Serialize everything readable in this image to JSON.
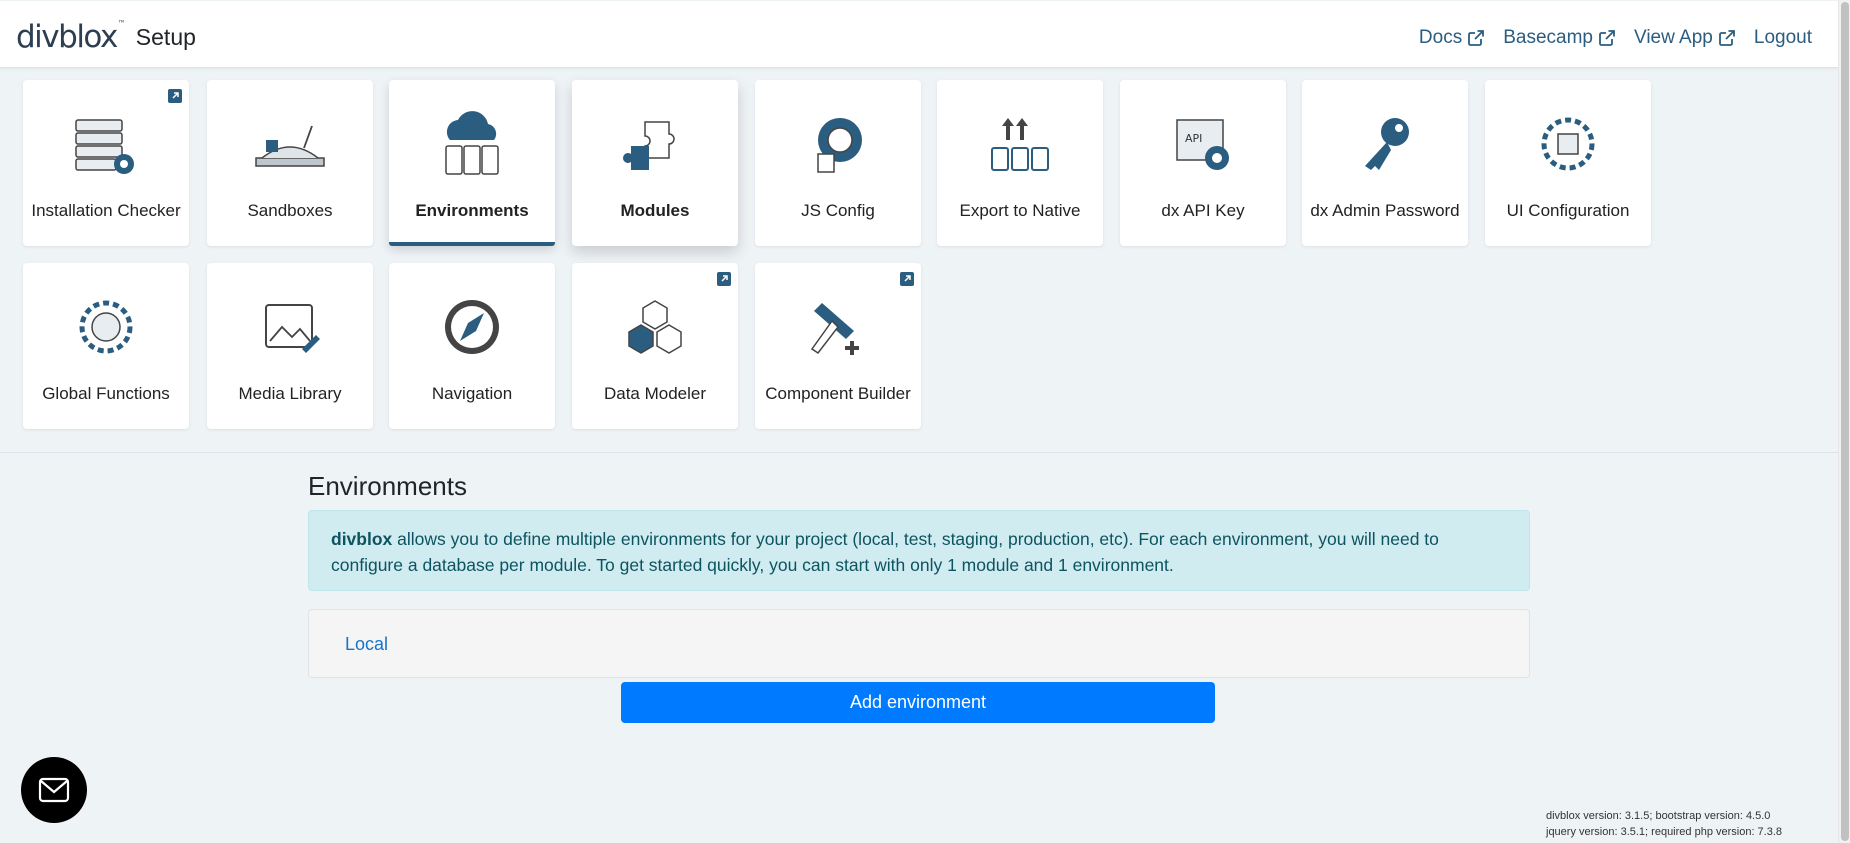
{
  "navbar": {
    "brand_logo": "divblox",
    "brand_tm": "™",
    "brand_title": "Setup",
    "links": [
      {
        "label": "Docs",
        "external": true
      },
      {
        "label": "Basecamp",
        "external": true
      },
      {
        "label": "View App",
        "external": true
      },
      {
        "label": "Logout",
        "external": false
      }
    ]
  },
  "tiles": [
    {
      "label": "Installation Checker",
      "icon": "server-gear-icon",
      "external": true
    },
    {
      "label": "Sandboxes",
      "icon": "sandbox-icon",
      "external": false
    },
    {
      "label": "Environments",
      "icon": "cloud-servers-icon",
      "external": false,
      "active": true
    },
    {
      "label": "Modules",
      "icon": "puzzle-icon",
      "external": false
    },
    {
      "label": "JS Config",
      "icon": "gear-wrench-icon",
      "external": false
    },
    {
      "label": "Export to Native",
      "icon": "export-icon",
      "external": false
    },
    {
      "label": "dx API Key",
      "icon": "api-gear-icon",
      "external": false
    },
    {
      "label": "dx Admin Password",
      "icon": "key-icon",
      "external": false
    },
    {
      "label": "UI Configuration",
      "icon": "ui-gear-icon",
      "external": false
    },
    {
      "label": "Global Functions",
      "icon": "globe-gear-icon",
      "external": false
    },
    {
      "label": "Media Library",
      "icon": "image-edit-icon",
      "external": false
    },
    {
      "label": "Navigation",
      "icon": "compass-icon",
      "external": false
    },
    {
      "label": "Data Modeler",
      "icon": "cubes-icon",
      "external": true
    },
    {
      "label": "Component Builder",
      "icon": "hammer-plus-icon",
      "external": true
    }
  ],
  "section": {
    "title": "Environments",
    "alert_brand": "divblox",
    "alert_text": " allows you to define multiple environments for your project (local, test, staging, production, etc). For each environment, you will need to configure a database per module. To get started quickly, you can start with only 1 module and 1 environment.",
    "environments": [
      "Local"
    ],
    "add_button": "Add environment"
  },
  "footer": {
    "line1": "divblox version: 3.1.5; bootstrap version: 4.5.0",
    "line2": "jquery version: 3.5.1; required php version: 7.3.8"
  },
  "colors": {
    "accent": "#2a5d80",
    "primary_button": "#007bff",
    "alert_bg": "#d1ecf1",
    "page_bg": "#eef3f6"
  }
}
